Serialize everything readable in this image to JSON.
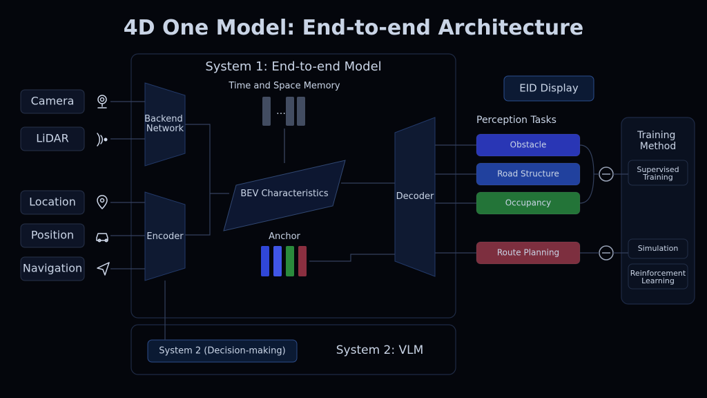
{
  "title": "4D One Model: End-to-end Architecture",
  "inputs": {
    "camera": "Camera",
    "lidar": "LiDAR",
    "location": "Location",
    "position": "Position",
    "navigation": "Navigation"
  },
  "system1": {
    "title": "System 1: End-to-end Model",
    "backend": "Backend Network",
    "encoder": "Encoder",
    "memory": "Time and Space Memory",
    "memory_ellipsis": "…",
    "bev": "BEV Characteristics",
    "anchor": "Anchor",
    "decoder": "Decoder"
  },
  "system2": {
    "box": "System 2 (Decision-making)",
    "title": "System 2: VLM"
  },
  "right": {
    "eid": "EID Display",
    "perception_title": "Perception Tasks",
    "tasks": {
      "obstacle": "Obstacle",
      "road": "Road Structure",
      "occupancy": "Occupancy",
      "route": "Route Planning"
    },
    "training": {
      "title": "Training Method",
      "supervised": "Supervised Training",
      "simulation": "Simulation",
      "reinforcement": "Reinforcement Learning"
    }
  },
  "colors": {
    "bg": "#04060c",
    "panel_stroke": "#1f2b45",
    "line": "#34415e",
    "task_blue": "#2936b5",
    "task_blue2": "#21419e",
    "task_green": "#237438",
    "task_red": "#7d2f3f",
    "eid_stroke": "#2a4d8e"
  }
}
